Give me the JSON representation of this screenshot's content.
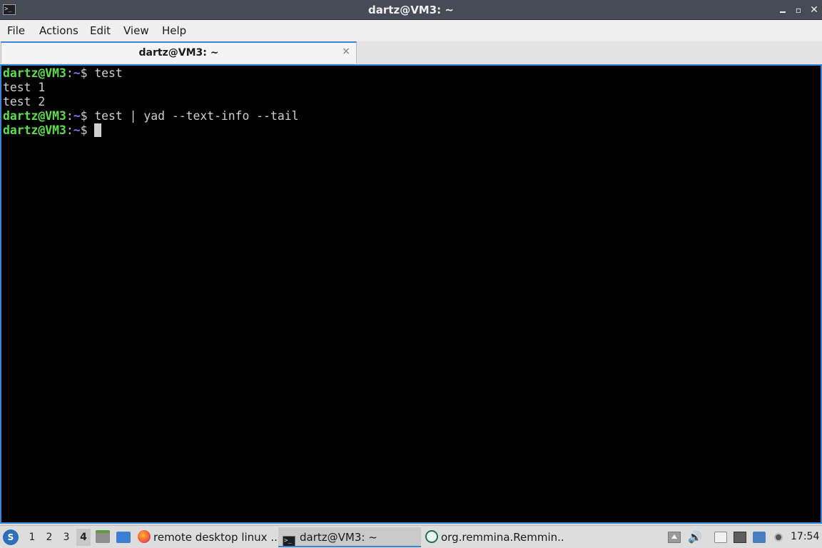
{
  "window": {
    "title": "dartz@VM3: ~",
    "app_icon_glyph": ">_",
    "minimize_glyph": "",
    "maximize_glyph": "▫",
    "close_glyph": "✕"
  },
  "menu": [
    "File",
    "Actions",
    "Edit",
    "View",
    "Help"
  ],
  "tab": {
    "label": "dartz@VM3: ~",
    "close_glyph": "×"
  },
  "terminal": {
    "lines": [
      {
        "user": "dartz@VM3",
        "sep": ":",
        "path": "~",
        "prompt": "$ ",
        "text": "test"
      },
      {
        "text": "test 1"
      },
      {
        "text": "test 2"
      },
      {
        "user": "dartz@VM3",
        "sep": ":",
        "path": "~",
        "prompt": "$ ",
        "text": "test | yad --text-info --tail"
      },
      {
        "user": "dartz@VM3",
        "sep": ":",
        "path": "~",
        "prompt": "$ ",
        "text": ""
      }
    ],
    "colors": {
      "background": "#000000",
      "user": "#5fe04a",
      "path": "#7878ff",
      "text": "#cfcfcf"
    }
  },
  "taskbar": {
    "start_glyph": "S",
    "workspaces": [
      "1",
      "2",
      "3",
      "4"
    ],
    "active_workspace": "4",
    "tasks": [
      {
        "label": "remote desktop linux ...",
        "icon": "firefox-icon"
      },
      {
        "label": "dartz@VM3: ~",
        "icon": "terminal-icon"
      },
      {
        "label": "org.remmina.Remmin...",
        "icon": "remmina-icon"
      }
    ],
    "volume_glyph": "🔊",
    "clock": "17:54"
  },
  "colors": {
    "accent": "#3b86d4",
    "titlebar": "#464c55"
  }
}
